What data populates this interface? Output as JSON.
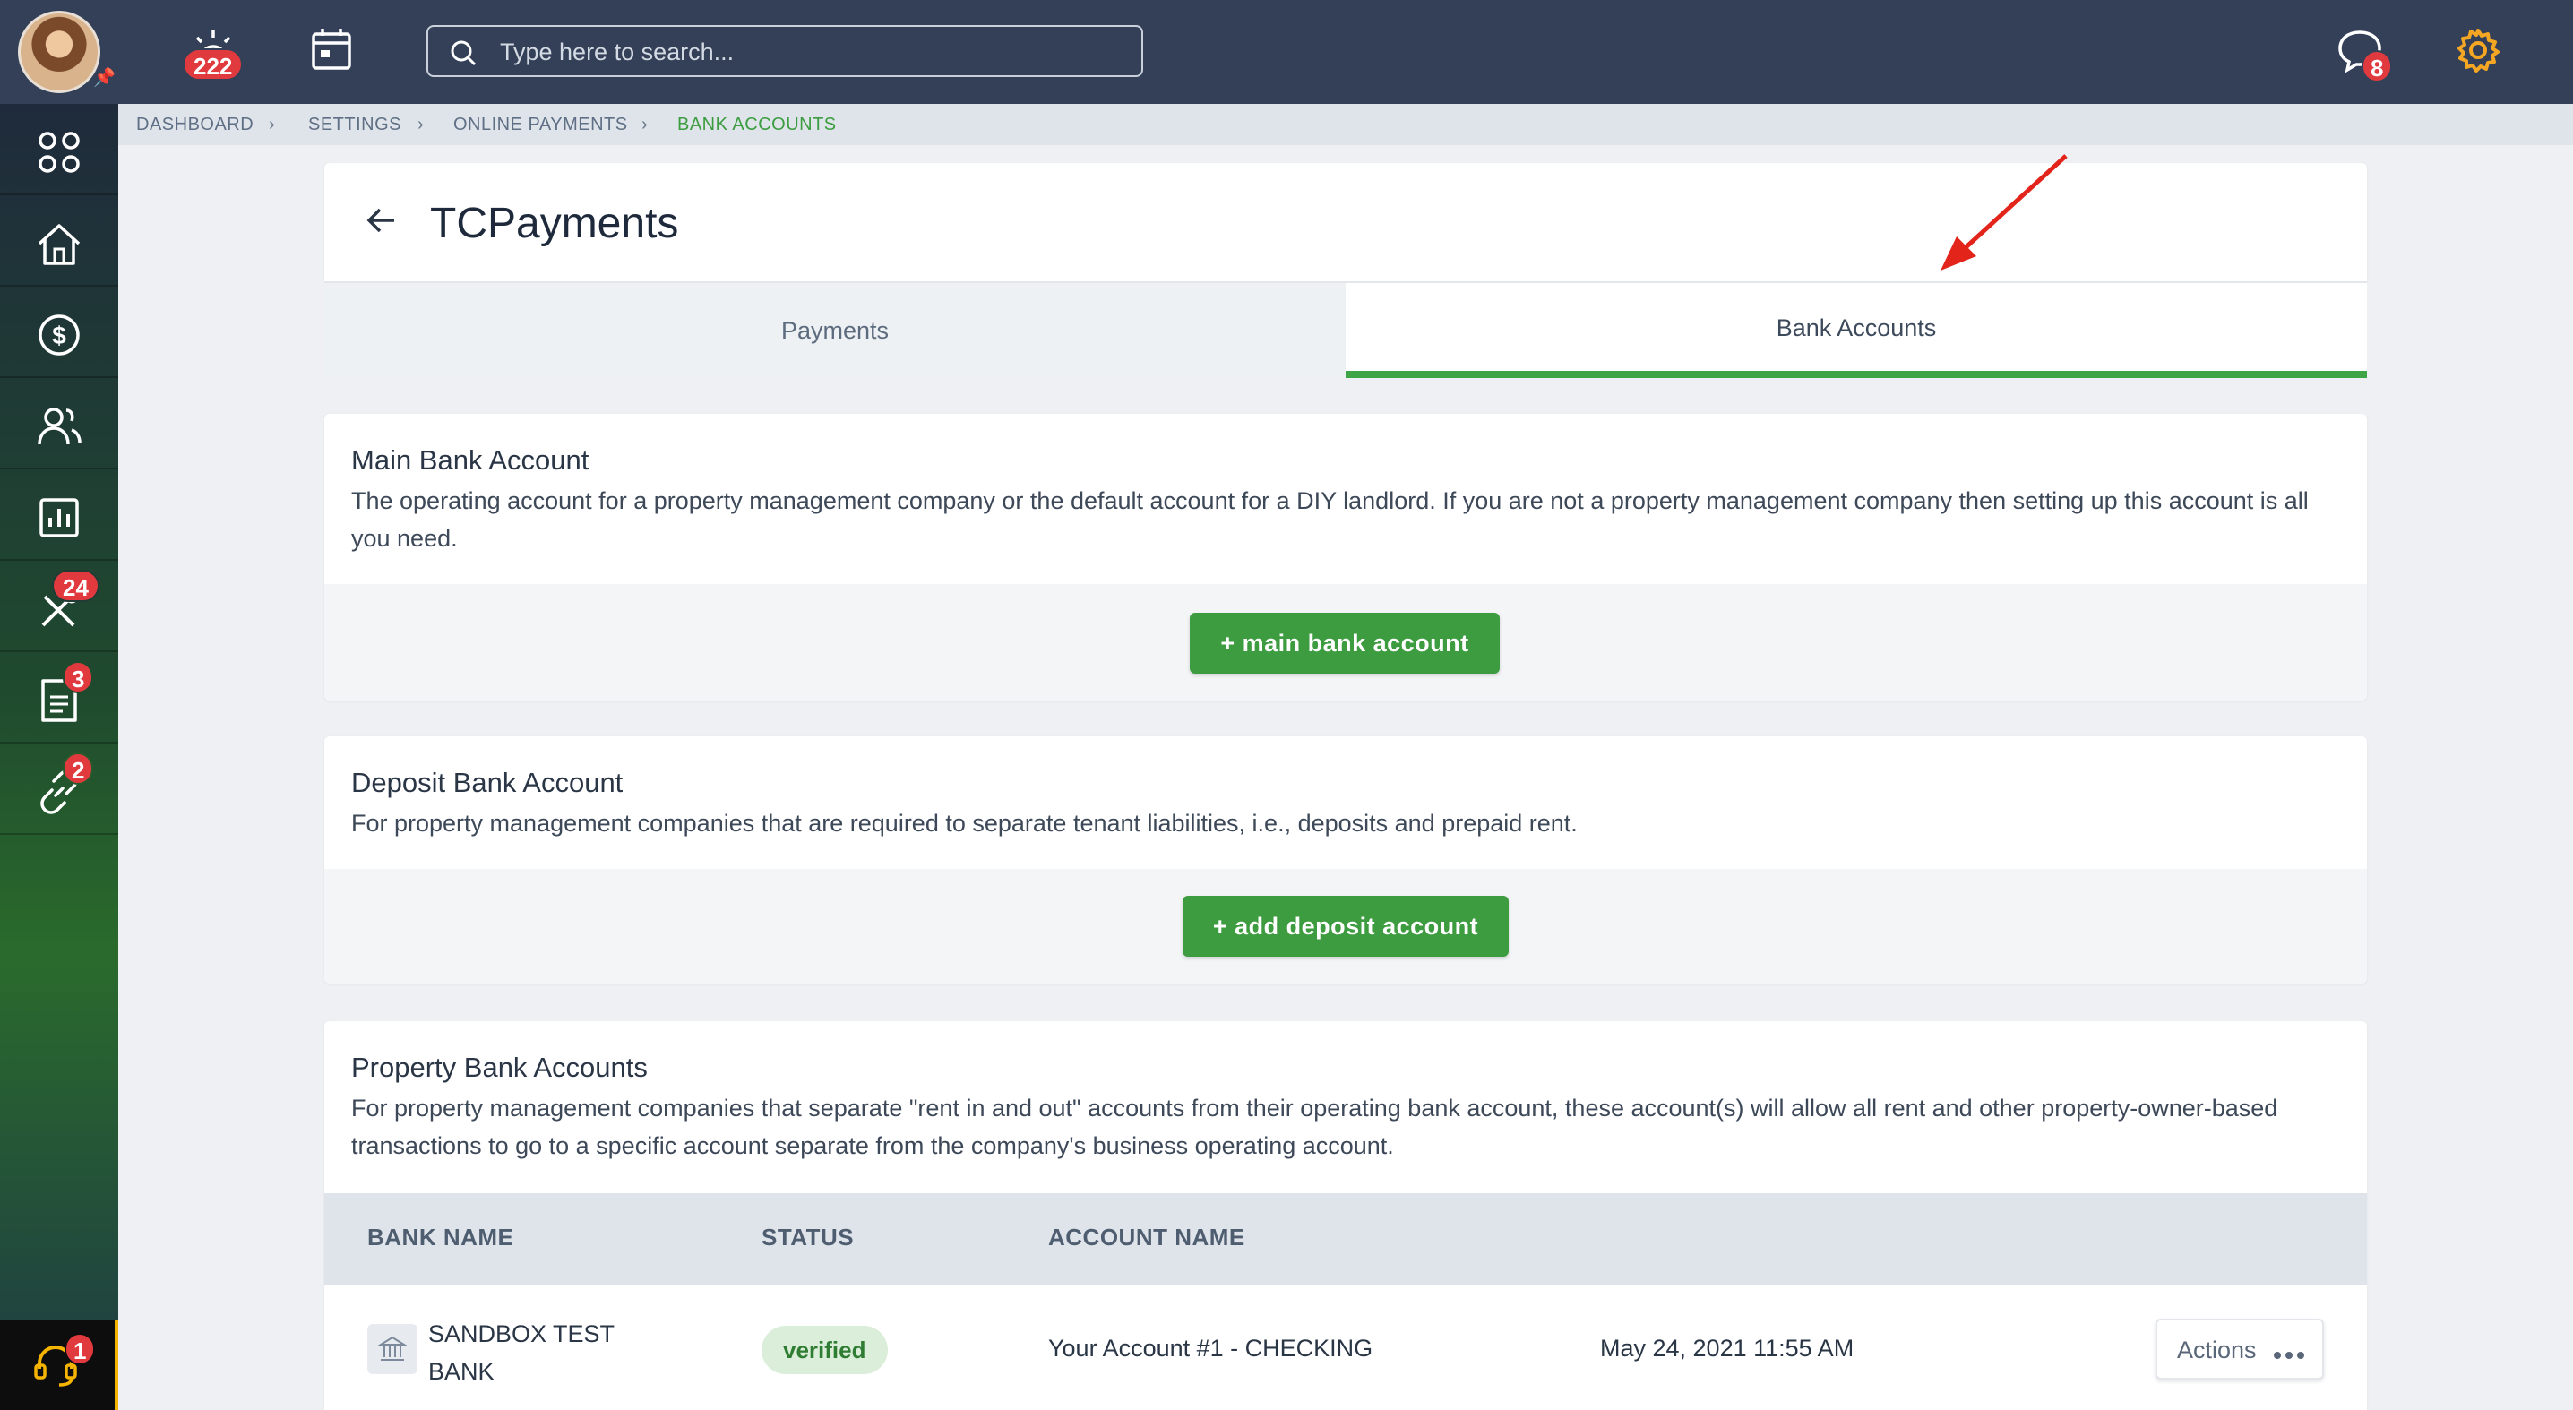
{
  "topbar": {
    "notifications_count": "222",
    "search_placeholder": "Type here to search...",
    "messages_count": "8"
  },
  "sidebar": {
    "items": [
      {
        "icon": "apps-grid-icon"
      },
      {
        "icon": "home-icon"
      },
      {
        "icon": "dollar-icon"
      },
      {
        "icon": "people-icon"
      },
      {
        "icon": "reports-icon"
      },
      {
        "icon": "tools-icon",
        "badge": "24"
      },
      {
        "icon": "document-icon",
        "badge": "3"
      },
      {
        "icon": "link-icon",
        "badge": "2"
      }
    ],
    "support_badge": "1"
  },
  "breadcrumb": {
    "items": [
      "DASHBOARD",
      "SETTINGS",
      "ONLINE PAYMENTS",
      "BANK ACCOUNTS"
    ]
  },
  "page": {
    "title": "TCPayments"
  },
  "tabs": {
    "payments": "Payments",
    "bank_accounts": "Bank Accounts",
    "active": "bank_accounts"
  },
  "main_bank": {
    "title": "Main Bank Account",
    "description": "The operating account for a property management company or the default account for a DIY landlord. If you are not a property management company then setting up this account is all you need.",
    "button": "+ main bank account"
  },
  "deposit_bank": {
    "title": "Deposit Bank Account",
    "description": "For property management companies that are required to separate tenant liabilities, i.e., deposits and prepaid rent.",
    "button": "+ add deposit account"
  },
  "property_bank": {
    "title": "Property Bank Accounts",
    "description": "For property management companies that separate \"rent in and out\" accounts from their operating bank account, these account(s) will allow all rent and other property-owner-based transactions to go to a specific account separate from the company's business operating account.",
    "columns": [
      "BANK NAME",
      "STATUS",
      "ACCOUNT NAME"
    ],
    "rows": [
      {
        "bank_name": "SANDBOX TEST BANK",
        "status": "verified",
        "account_name": "Your Account #1 - CHECKING",
        "date": "May 24, 2021 11:55 AM",
        "actions_label": "Actions"
      }
    ]
  },
  "colors": {
    "topbar": "#334058",
    "accent_green": "#3d9c3f",
    "badge_red": "#e0393e",
    "settings_orange": "#f5a623"
  }
}
